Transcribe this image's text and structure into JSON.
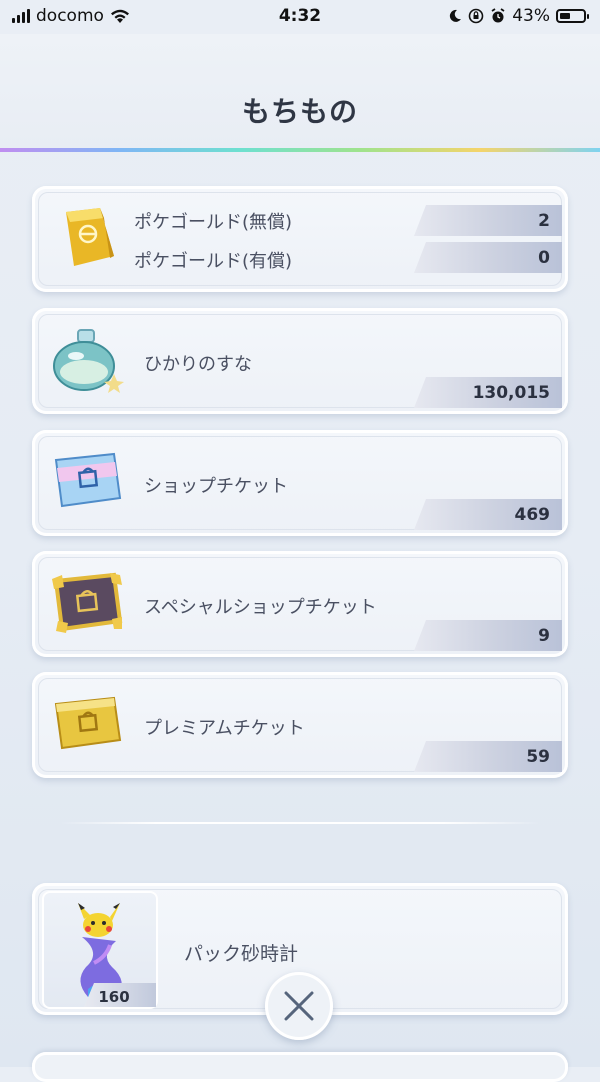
{
  "status_bar": {
    "carrier": "docomo",
    "time": "4:32",
    "battery": "43%"
  },
  "header": {
    "title": "もちもの"
  },
  "items": [
    {
      "label": "ポケゴールド(無償)",
      "count": "2",
      "icon": "gold-bar-icon"
    },
    {
      "label": "ポケゴールド(有償)",
      "count": "0",
      "icon": "gold-bar-icon"
    },
    {
      "label": "ひかりのすな",
      "count": "130,015",
      "icon": "shining-sand-bottle-icon"
    },
    {
      "label": "ショップチケット",
      "count": "469",
      "icon": "shop-ticket-icon"
    },
    {
      "label": "スペシャルショップチケット",
      "count": "9",
      "icon": "special-shop-ticket-icon"
    },
    {
      "label": "プレミアムチケット",
      "count": "59",
      "icon": "premium-ticket-icon"
    }
  ],
  "hourglass": {
    "label": "パック砂時計",
    "count": "160",
    "icon": "pack-hourglass-icon"
  },
  "close": {
    "icon": "close-icon"
  }
}
